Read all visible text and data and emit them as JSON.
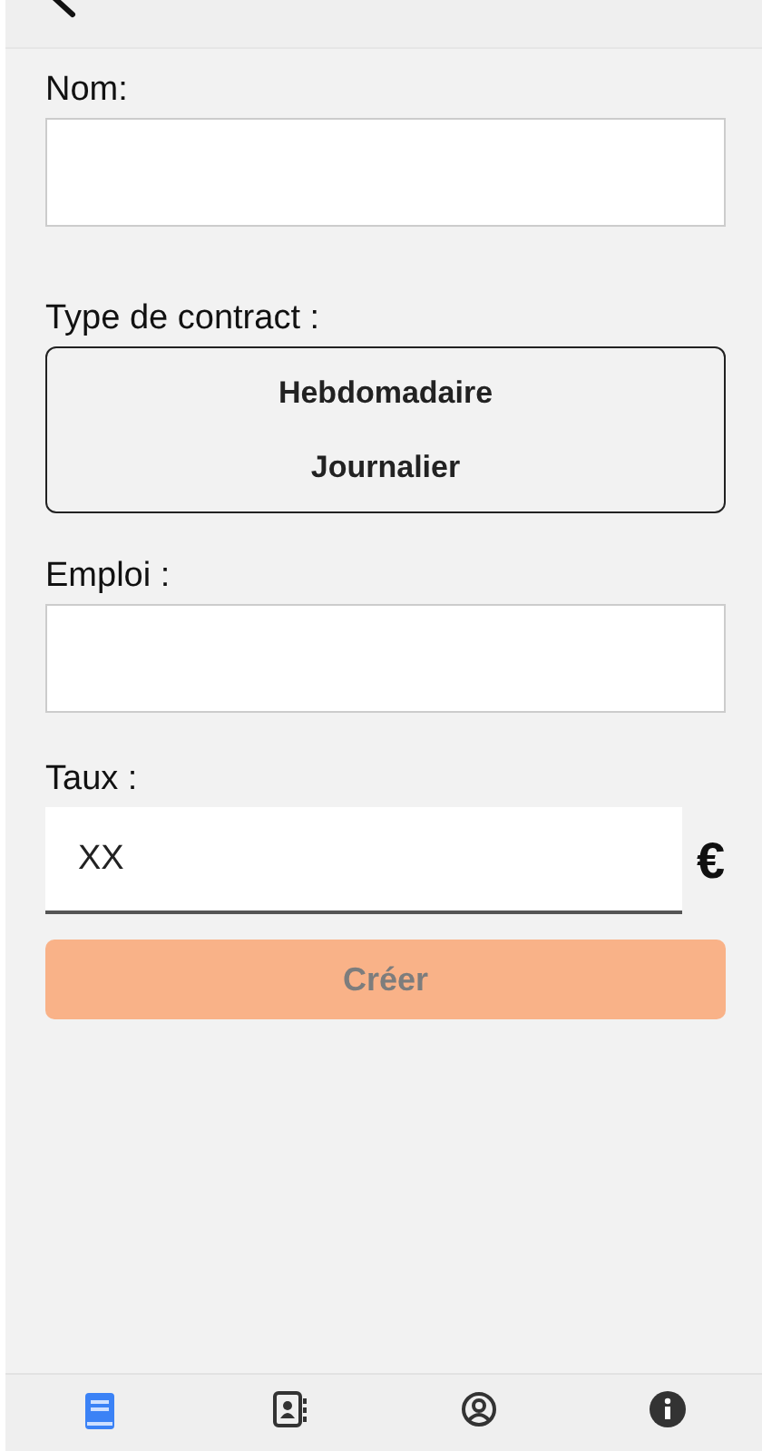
{
  "form": {
    "fields": [
      {
        "kind": "text",
        "label": "Nom:"
      },
      {
        "kind": "choice",
        "label": "Type de contract :",
        "options": [
          {
            "label": "Hebdomadaire",
            "selected": false
          },
          {
            "label": "Journalier",
            "selected": false
          }
        ]
      },
      {
        "kind": "text",
        "label": "Emploi :"
      },
      {
        "kind": "currency",
        "label": "Taux :",
        "placeholder": "XX",
        "unit": "€"
      }
    ],
    "submit": {
      "label": "Créer",
      "disabled": true
    }
  },
  "tabs": [
    {
      "kind": "book",
      "selected": true
    },
    {
      "kind": "contacts",
      "selected": false
    },
    {
      "kind": "user",
      "selected": false
    },
    {
      "kind": "info",
      "selected": false
    }
  ]
}
